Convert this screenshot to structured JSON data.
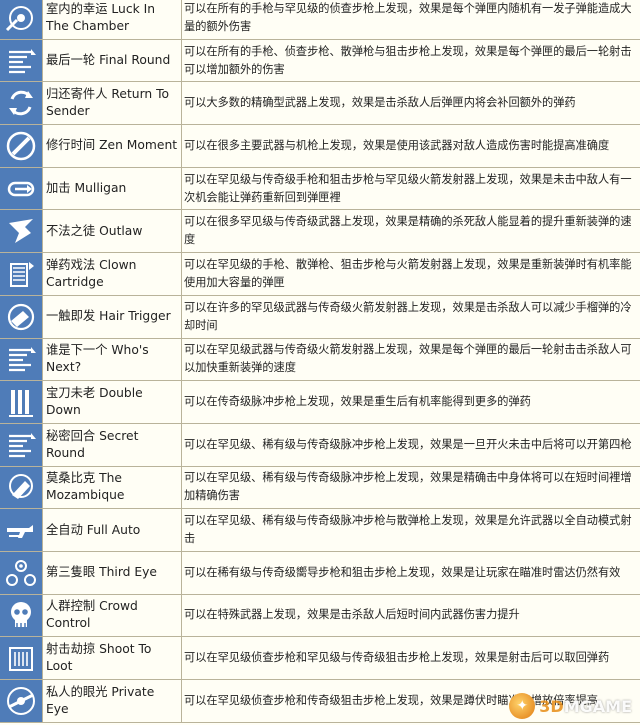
{
  "perks": [
    {
      "icon": "target-icon",
      "name": "室内的幸运 Luck In The Chamber",
      "desc": "可以在所有的手枪与罕见级的侦查步枪上发现，效果是每个弹匣内随机有一发子弹能造成大量的额外伤害"
    },
    {
      "icon": "bullet-lines-icon",
      "name": "最后一轮 Final Round",
      "desc": "可以在所有的手枪、侦查步枪、散弹枪与狙击步枪上发现，效果是每个弹匣的最后一轮射击可以增加额外的伤害"
    },
    {
      "icon": "return-arrows-icon",
      "name": "归还寄件人 Return To Sender",
      "desc": "可以大多数的精确型武器上发现，效果是击杀敌人后弹匣内将会补回额外的弹药"
    },
    {
      "icon": "zen-circle-icon",
      "name": "修行时间 Zen Moment",
      "desc": "可以在很多主要武器与机枪上发现，效果是使用该武器对敌人造成伤害时能提高准确度"
    },
    {
      "icon": "reload-loop-icon",
      "name": "加击 Mulligan",
      "desc": "可以在罕见级与传奇级手枪和狙击步枪与罕见级火箭发射器上发现，效果是未击中敌人有一次机会能让弹药重新回到弹匣裡"
    },
    {
      "icon": "outlaw-hand-icon",
      "name": "不法之徒 Outlaw",
      "desc": "可以在很多罕见级与传奇级武器上发现，效果是精确的杀死敌人能显着的提升重新装弹的速度"
    },
    {
      "icon": "magazine-icon",
      "name": "弹药戏法 Clown Cartridge",
      "desc": "可以在罕见级的手枪、散弹枪、狙击步枪与火箭发射器上发现，效果是重新装弹时有机率能使用加大容量的弹匣"
    },
    {
      "icon": "trigger-hand-icon",
      "name": "一触即发 Hair Trigger",
      "desc": "可以在许多的罕见级武器与传奇级火箭发射器上发现，效果是击杀敌人可以减少手榴弹的冷却时间"
    },
    {
      "icon": "bullet-lines-icon",
      "name": "谁是下一个 Who's Next?",
      "desc": "可以在罕见级武器与传奇级火箭发射器上发现，效果是每个弹匣的最后一轮射击击杀敌人可以加快重新装弹的速度"
    },
    {
      "icon": "bars-icon",
      "name": "宝刀未老 Double Down",
      "desc": "可以在传奇级脉冲步枪上发现，效果是重生后有机率能得到更多的弹药"
    },
    {
      "icon": "bullet-lines-icon",
      "name": "秘密回合 Secret Round",
      "desc": "可以在罕见级、稀有级与传奇级脉冲步枪上发现，效果是一旦开火未击中后将可以开第四枪"
    },
    {
      "icon": "target-hand-icon",
      "name": "莫桑比克 The Mozambique",
      "desc": "可以在罕见级、稀有级与传奇级脉冲步枪上发现，效果是精确击中身体将可以在短时间裡增加精确伤害"
    },
    {
      "icon": "rifle-icon",
      "name": "全自动 Full Auto",
      "desc": "可以在罕见级、稀有级与传奇级脉冲步枪与散弹枪上发现，效果是允许武器以全自动模式射击"
    },
    {
      "icon": "third-eye-icon",
      "name": "第三隻眼 Third Eye",
      "desc": "可以在稀有级与传奇级嚮导步枪和狙击步枪上发现，效果是让玩家在瞄准时雷达仍然有效"
    },
    {
      "icon": "skull-icon",
      "name": "人群控制 Crowd Control",
      "desc": "可以在特殊武器上发现，效果是击杀敌人后短时间内武器伤害力提升"
    },
    {
      "icon": "loot-icon",
      "name": "射击劫掠 Shoot To Loot",
      "desc": "可以在罕见级侦查步枪和罕见级与传奇级狙击步枪上发现，效果是射击后可以取回弹药"
    },
    {
      "icon": "eye-icon",
      "name": "私人的眼光 Private Eye",
      "desc": "可以在罕见级侦查步枪和传奇级狙击步枪上发现，效果是蹲伏时瞄准能增放倍率提高"
    }
  ],
  "watermark": {
    "num": "3D",
    "rest": "MGAME"
  }
}
